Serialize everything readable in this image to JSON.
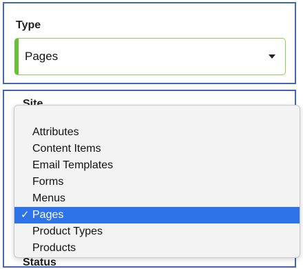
{
  "type_field": {
    "label": "Type",
    "selected_value": "Pages"
  },
  "site_section": {
    "label": "Site"
  },
  "status_section": {
    "label": "Status"
  },
  "dropdown": {
    "items": [
      {
        "label": "Attributes",
        "selected": false
      },
      {
        "label": "Content Items",
        "selected": false
      },
      {
        "label": "Email Templates",
        "selected": false
      },
      {
        "label": "Forms",
        "selected": false
      },
      {
        "label": "Menus",
        "selected": false
      },
      {
        "label": "Pages",
        "selected": true,
        "mark": "✓"
      },
      {
        "label": "Product Types",
        "selected": false
      },
      {
        "label": "Products",
        "selected": false
      }
    ]
  },
  "colors": {
    "panel_border": "#3f67b5",
    "select_accent": "#69bf35",
    "selected_bg": "#2e74e8"
  }
}
